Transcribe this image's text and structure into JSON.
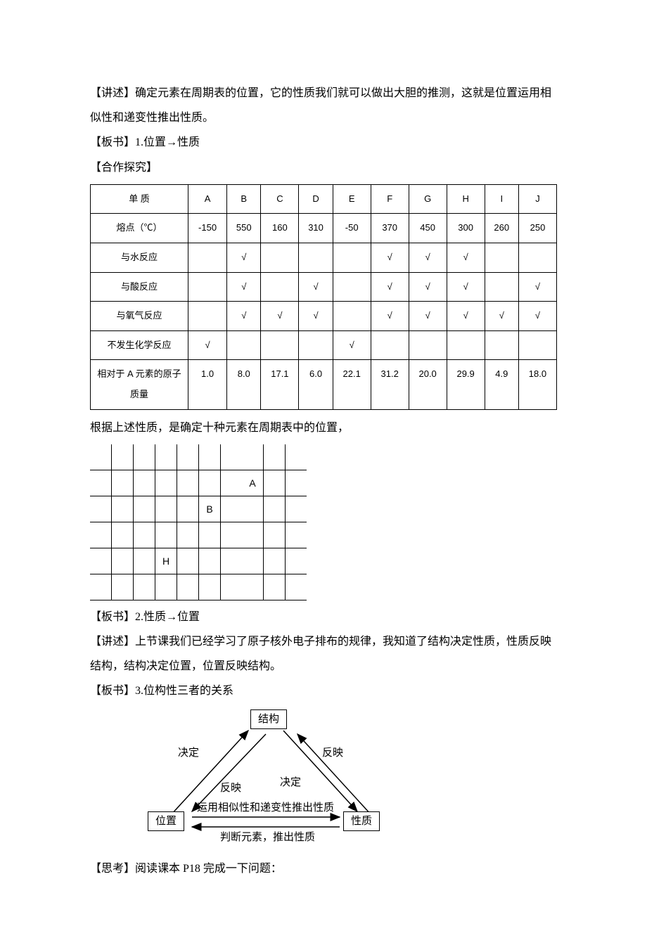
{
  "paragraphs": {
    "p1": "【讲述】确定元素在周期表的位置，它的性质我们就可以做出大胆的推测，这就是位置运用相似性和递变性推出性质。",
    "p2": "【板书】1.位置→性质",
    "p3": "【合作探究】",
    "p4": "根据上述性质，是确定十种元素在周期表中的位置，",
    "p5": "【板书】2.性质→位置",
    "p6": "【讲述】上节课我们已经学习了原子核外电子排布的规律，我知道了结构决定性质，性质反映结构，结构决定位置，位置反映结构。",
    "p7": "【板书】3.位构性三者的关系",
    "p8": "【思考】阅读课本 P18 完成一下问题："
  },
  "table1": {
    "headers": [
      "单   质",
      "A",
      "B",
      "C",
      "D",
      "E",
      "F",
      "G",
      "H",
      "I",
      "J"
    ],
    "rows": [
      {
        "label": "熔点（℃）",
        "cells": [
          "-150",
          "550",
          "160",
          "310",
          "-50",
          "370",
          "450",
          "300",
          "260",
          "250"
        ]
      },
      {
        "label": "与水反应",
        "cells": [
          "",
          "√",
          "",
          "",
          "",
          "√",
          "√",
          "√",
          "",
          ""
        ]
      },
      {
        "label": "与酸反应",
        "cells": [
          "",
          "√",
          "",
          "√",
          "",
          "√",
          "√",
          "√",
          "",
          "√"
        ]
      },
      {
        "label": "与氧气反应",
        "cells": [
          "",
          "√",
          "√",
          "√",
          "",
          "√",
          "√",
          "√",
          "√",
          "√"
        ]
      },
      {
        "label": "不发生化学反应",
        "cells": [
          "√",
          "",
          "",
          "",
          "√",
          "",
          "",
          "",
          "",
          ""
        ]
      },
      {
        "label": "相对于 A 元素的原子质量",
        "cells": [
          "1.0",
          "8.0",
          "17.1",
          "6.0",
          "22.1",
          "31.2",
          "20.0",
          "29.9",
          "4.9",
          "18.0"
        ]
      }
    ]
  },
  "pt": {
    "r2c8": "A",
    "r3c6": "B",
    "r5c4": "H"
  },
  "diagram": {
    "boxTop": "结构",
    "boxLeft": "位置",
    "boxRight": "性质",
    "lblTL": "决定",
    "lblTR": "反映",
    "lblML": "反映",
    "lblMR": "决定",
    "lblMidTop": "运用相似性和递变性推出性质",
    "lblMidBot": "判断元素，推出性质"
  }
}
